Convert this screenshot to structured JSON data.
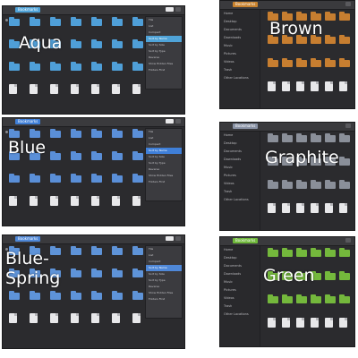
{
  "panels": [
    {
      "id": "aqua",
      "theme_name": "Aqua",
      "crumb": "Bookmarks",
      "accent": "#4fa3d8",
      "folder": "#4f9fd8",
      "menu": true
    },
    {
      "id": "brown",
      "theme_name": "Brown",
      "crumb": "Bookmarks",
      "accent": "#c9832e",
      "folder": "#c77e30",
      "menu": false
    },
    {
      "id": "blue",
      "theme_name": "Blue",
      "crumb": "Bookmarks",
      "accent": "#3f7fd8",
      "folder": "#5a8fd8",
      "menu": true
    },
    {
      "id": "graphite",
      "theme_name": "Graphite",
      "crumb": "Bookmarks",
      "accent": "#8a93a6",
      "folder": "#8a8f99",
      "menu": false
    },
    {
      "id": "blue-spring",
      "theme_name": "Blue-\nSpring",
      "crumb": "Bookmarks",
      "accent": "#4f88d8",
      "folder": "#5e93d8",
      "menu": true
    },
    {
      "id": "green",
      "theme_name": "Green",
      "crumb": "Bookmarks",
      "accent": "#6fb83a",
      "folder": "#74b83c",
      "menu": false
    }
  ],
  "sidebar_items": [
    "Home",
    "Desktop",
    "Documents",
    "Downloads",
    "Music",
    "Pictures",
    "Videos",
    "Trash",
    "Other Locations"
  ],
  "menu_items": [
    "Tile",
    "List",
    "Compact",
    "Sort by Name",
    "Sort by Size",
    "Sort by Type",
    "Reverse",
    "Show Hidden Files",
    "Folders First"
  ]
}
